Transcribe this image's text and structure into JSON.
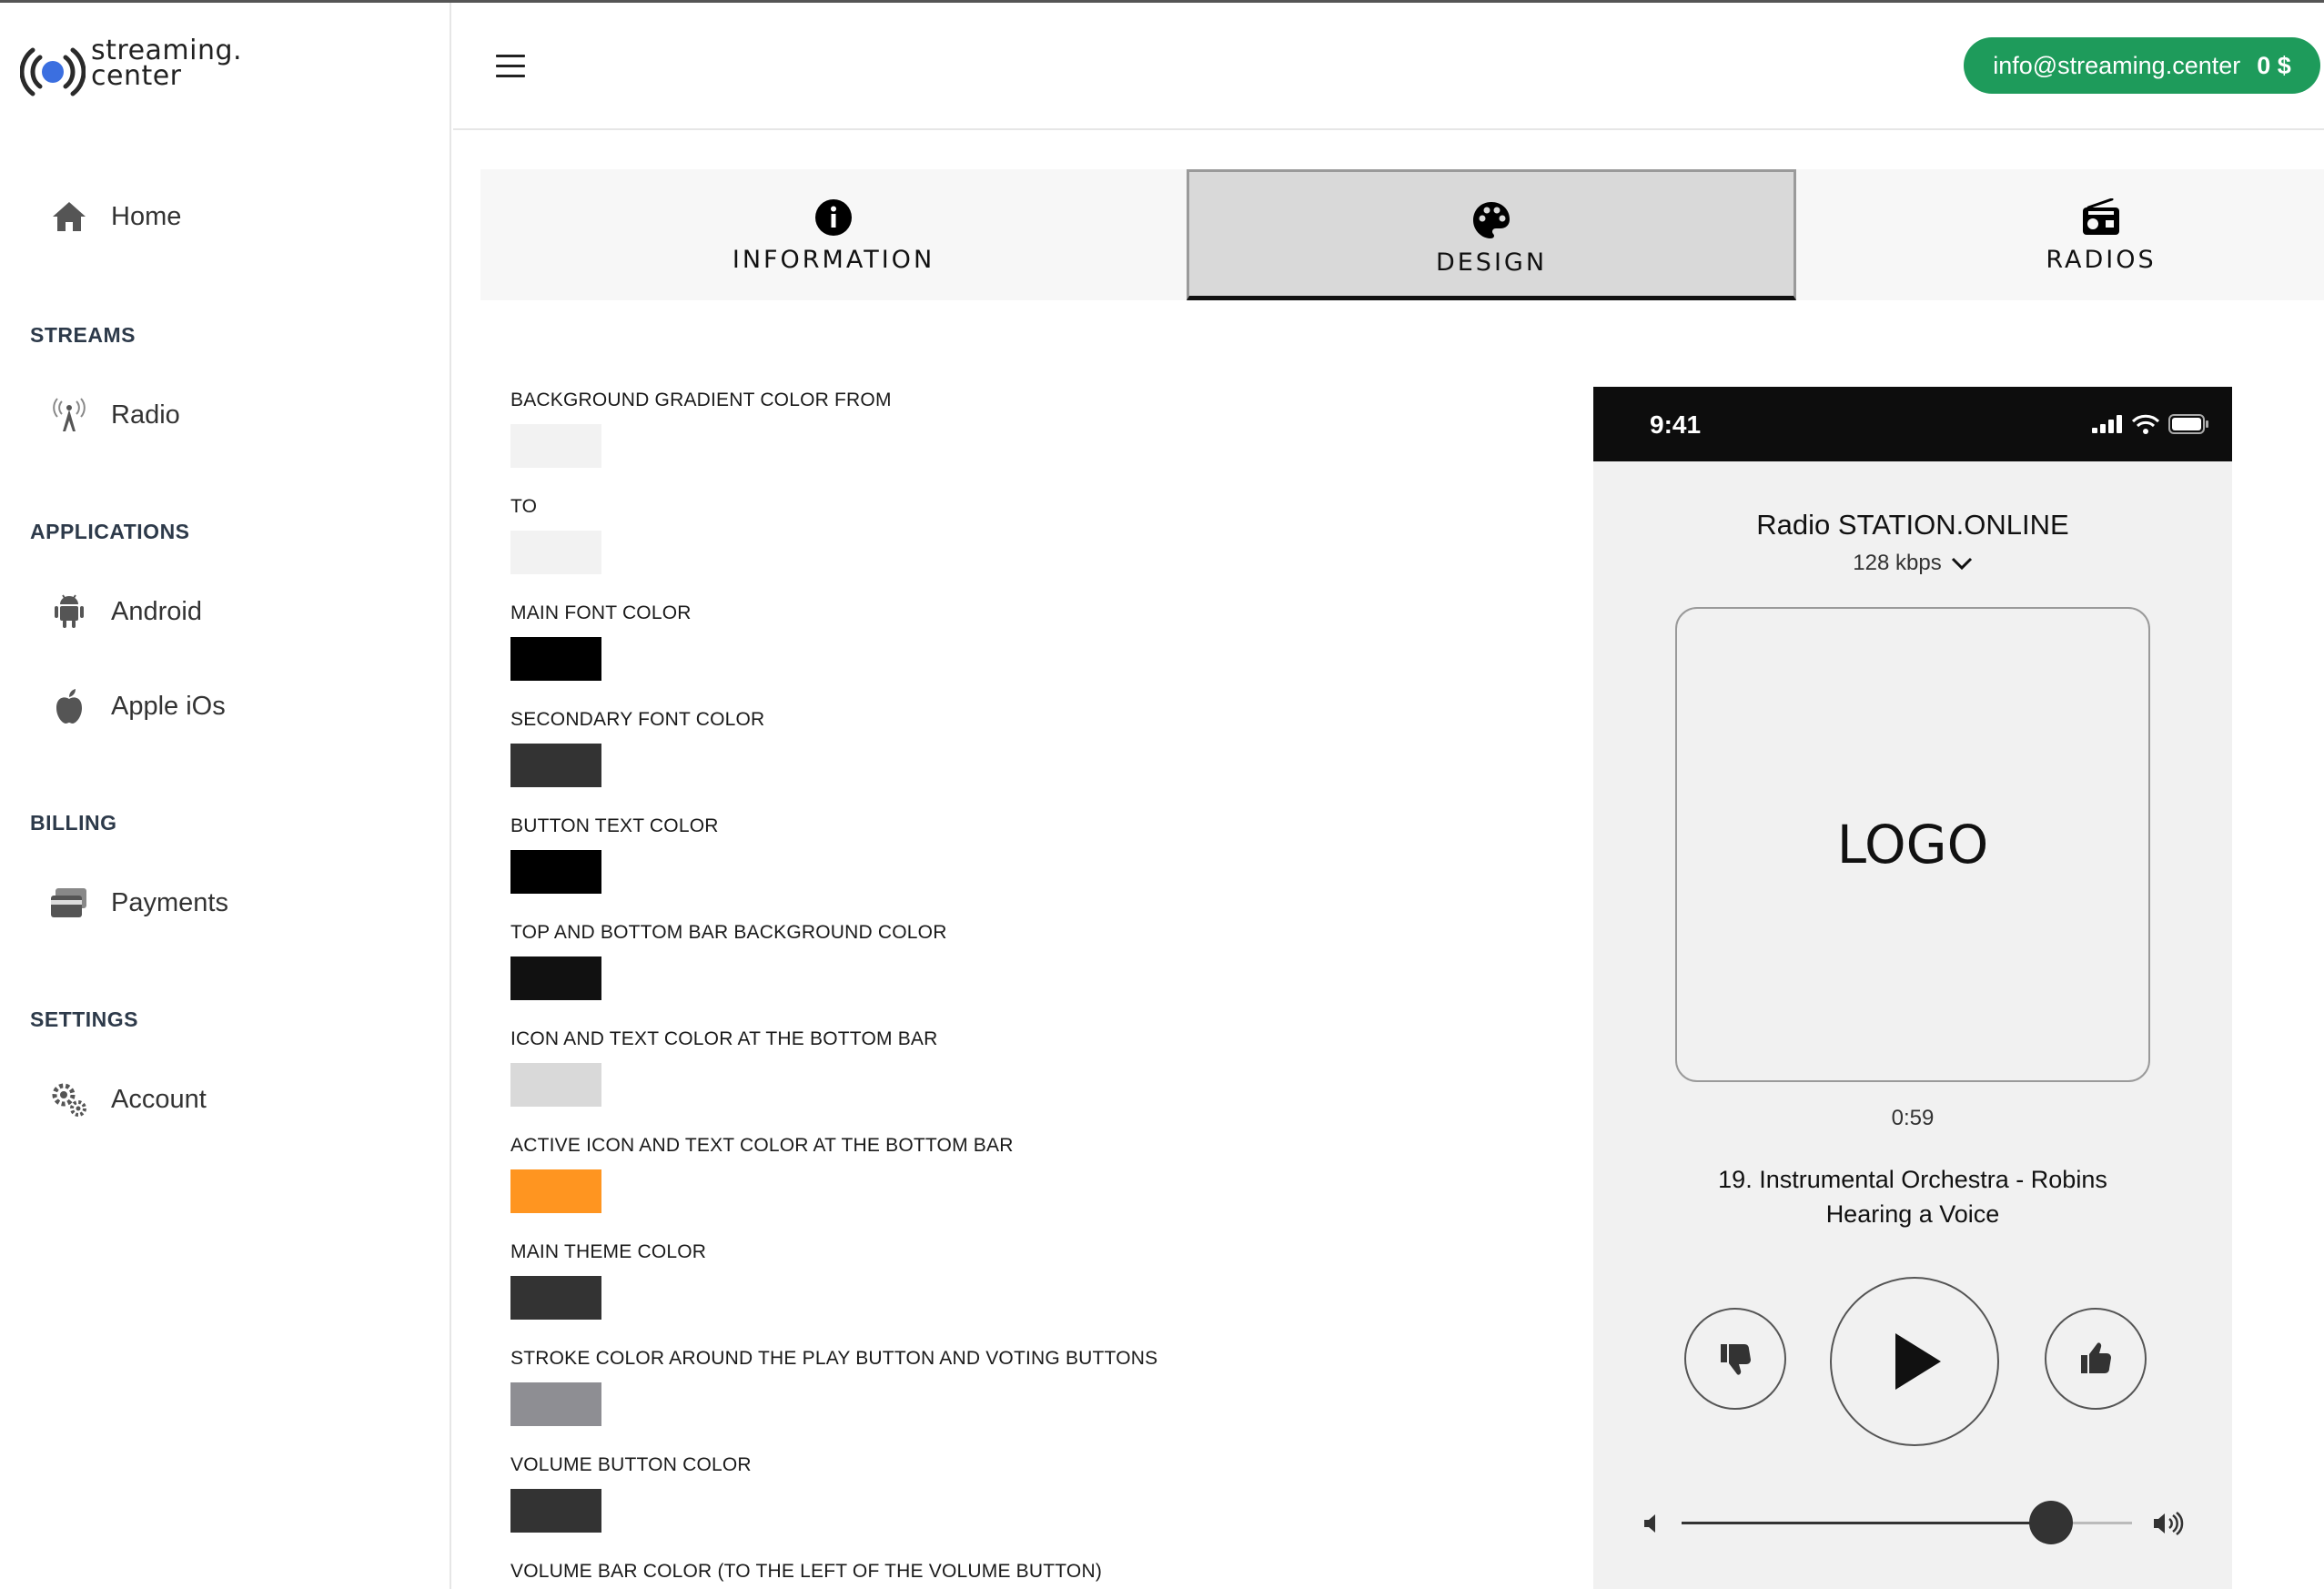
{
  "brand": {
    "line1": "streaming.",
    "line2": "center"
  },
  "sidebar": {
    "home": "Home",
    "sections": [
      {
        "title": "STREAMS",
        "items": [
          {
            "label": "Radio",
            "icon": "radio-tower-icon"
          }
        ]
      },
      {
        "title": "APPLICATIONS",
        "items": [
          {
            "label": "Android",
            "icon": "android-icon"
          },
          {
            "label": "Apple iOs",
            "icon": "apple-icon"
          }
        ]
      },
      {
        "title": "BILLING",
        "items": [
          {
            "label": "Payments",
            "icon": "credit-card-icon"
          }
        ]
      },
      {
        "title": "SETTINGS",
        "items": [
          {
            "label": "Account",
            "icon": "gears-icon"
          }
        ]
      }
    ]
  },
  "header": {
    "email": "info@streaming.center",
    "balance": "0 $"
  },
  "tabs": [
    {
      "label": "INFORMATION",
      "icon": "info-icon",
      "active": false
    },
    {
      "label": "DESIGN",
      "icon": "palette-icon",
      "active": true
    },
    {
      "label": "RADIOS",
      "icon": "radio-icon",
      "active": false
    }
  ],
  "fields": [
    {
      "label": "BACKGROUND GRADIENT COLOR FROM",
      "color": "#f2f2f2"
    },
    {
      "label": "TO",
      "color": "#f2f2f2"
    },
    {
      "label": "MAIN FONT COLOR",
      "color": "#000000"
    },
    {
      "label": "SECONDARY FONT COLOR",
      "color": "#333333"
    },
    {
      "label": "BUTTON TEXT COLOR",
      "color": "#000000"
    },
    {
      "label": "TOP AND BOTTOM BAR BACKGROUND COLOR",
      "color": "#111111"
    },
    {
      "label": "ICON AND TEXT COLOR AT THE BOTTOM BAR",
      "color": "#d9d9d9"
    },
    {
      "label": "ACTIVE ICON AND TEXT COLOR AT THE BOTTOM BAR",
      "color": "#ff9520"
    },
    {
      "label": "MAIN THEME COLOR",
      "color": "#333333"
    },
    {
      "label": "STROKE COLOR AROUND THE PLAY BUTTON AND VOTING BUTTONS",
      "color": "#8e8e93"
    },
    {
      "label": "VOLUME BUTTON COLOR",
      "color": "#333333"
    },
    {
      "label": "VOLUME BAR COLOR (TO THE LEFT OF THE VOLUME BUTTON)",
      "color": "#333333"
    }
  ],
  "preview": {
    "time": "9:41",
    "station": "Radio STATION.ONLINE",
    "bitrate": "128 kbps",
    "logo": "LOGO",
    "elapsed": "0:59",
    "track": "19. Instrumental Orchestra - Robins Hearing a Voice",
    "volume": 0.82
  },
  "colors": {
    "accent": "#1e9b5b",
    "brand_blue": "#3b6fe0"
  }
}
